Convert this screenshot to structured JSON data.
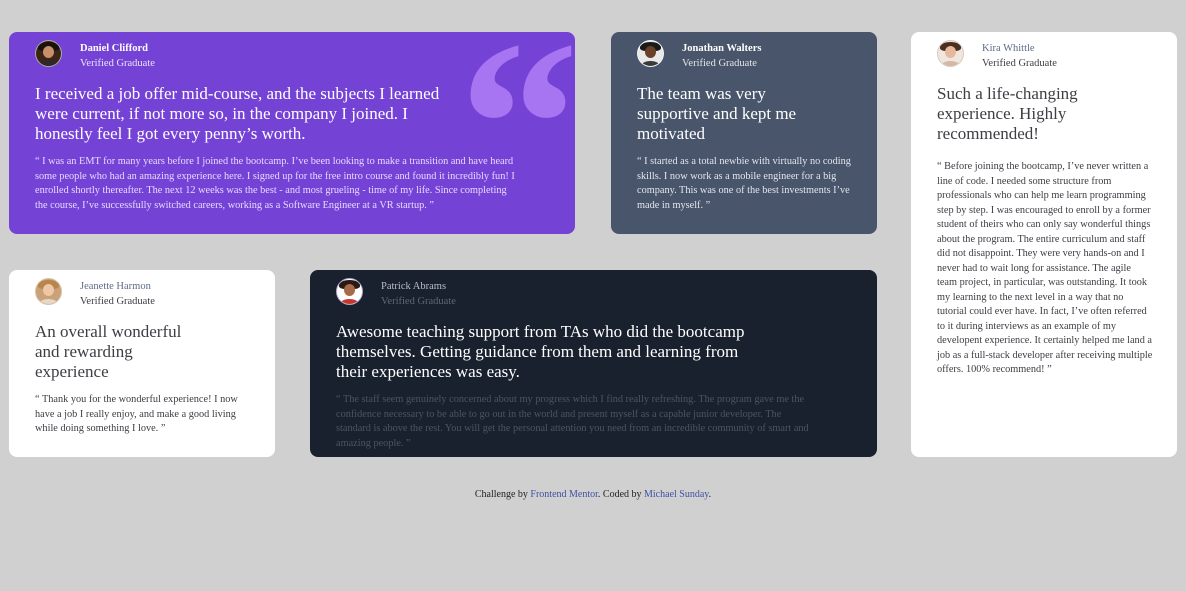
{
  "testimonials": [
    {
      "name": "Daniel Clifford",
      "role": "Verified Graduate",
      "headline": "I received a job offer mid-course, and the subjects I learned were current, if not more so, in the company I joined. I honestly feel I got every penny’s worth.",
      "quote": "“ I was an EMT for many years before I joined the bootcamp. I’ve been looking to make a transition and have heard some people who had an amazing experience here. I signed up for the free intro course and found it incredibly fun! I enrolled shortly thereafter. The next 12 weeks was the best - and most grueling - time of my life. Since completing the course, I’ve successfully switched careers, working as a Software Engineer at a VR startup. ”",
      "quote_mark": "“",
      "bg_color": "#7542d6"
    },
    {
      "name": "Jonathan Walters",
      "role": "Verified Graduate",
      "headline": "The team was very supportive and kept me motivated",
      "quote": "“ I started as a total newbie with virtually no coding skills. I now work as a mobile engineer for a big company. This was one of the best investments I’ve made in myself. ”",
      "bg_color": "#48556a"
    },
    {
      "name": "Kira Whittle",
      "role": "Verified Graduate",
      "headline": "Such a life-changing experience. Highly recommended!",
      "quote": "“ Before joining the bootcamp, I’ve never written a line of code. I needed some structure from professionals who can help me learn programming step by step. I was encouraged to enroll by a former student of theirs who can only say wonderful things about the program. The entire curriculum and staff did not disappoint. They were very hands-on and I never had to wait long for assistance. The agile team project, in particular, was outstanding. It took my learning to the next level in a way that no tutorial could ever have. In fact, I’ve often referred to it during interviews as an example of my developent experience. It certainly helped me land a job as a full-stack developer after receiving multiple offers. 100% recommend! ”",
      "bg_color": "#ffffff"
    },
    {
      "name": "Jeanette Harmon",
      "role": "Verified Graduate",
      "headline": "An overall wonderful and rewarding experience",
      "quote": "“ Thank you for the wonderful experience! I now have a job I really enjoy, and make a good living while doing something I love. ”",
      "bg_color": "#ffffff"
    },
    {
      "name": "Patrick Abrams",
      "role": "Verified Graduate",
      "headline": "Awesome teaching support from TAs who did the bootcamp themselves. Getting guidance from them and learning from their experiences was easy.",
      "quote": "“ The staff seem genuinely concerned about my progress which I find really refreshing. The program gave me the confidence necessary to be able to go out in the world and present myself as a capable junior developer. The standard is above the rest. You will get the personal attention you need from an incredible community of smart and amazing people. ”",
      "bg_color": "#19212e"
    }
  ],
  "footer": {
    "prefix": "Challenge by",
    "link1": "Frontend Mentor",
    "middle": ". Coded by",
    "link2": "Michael Sunday",
    "suffix": "."
  }
}
